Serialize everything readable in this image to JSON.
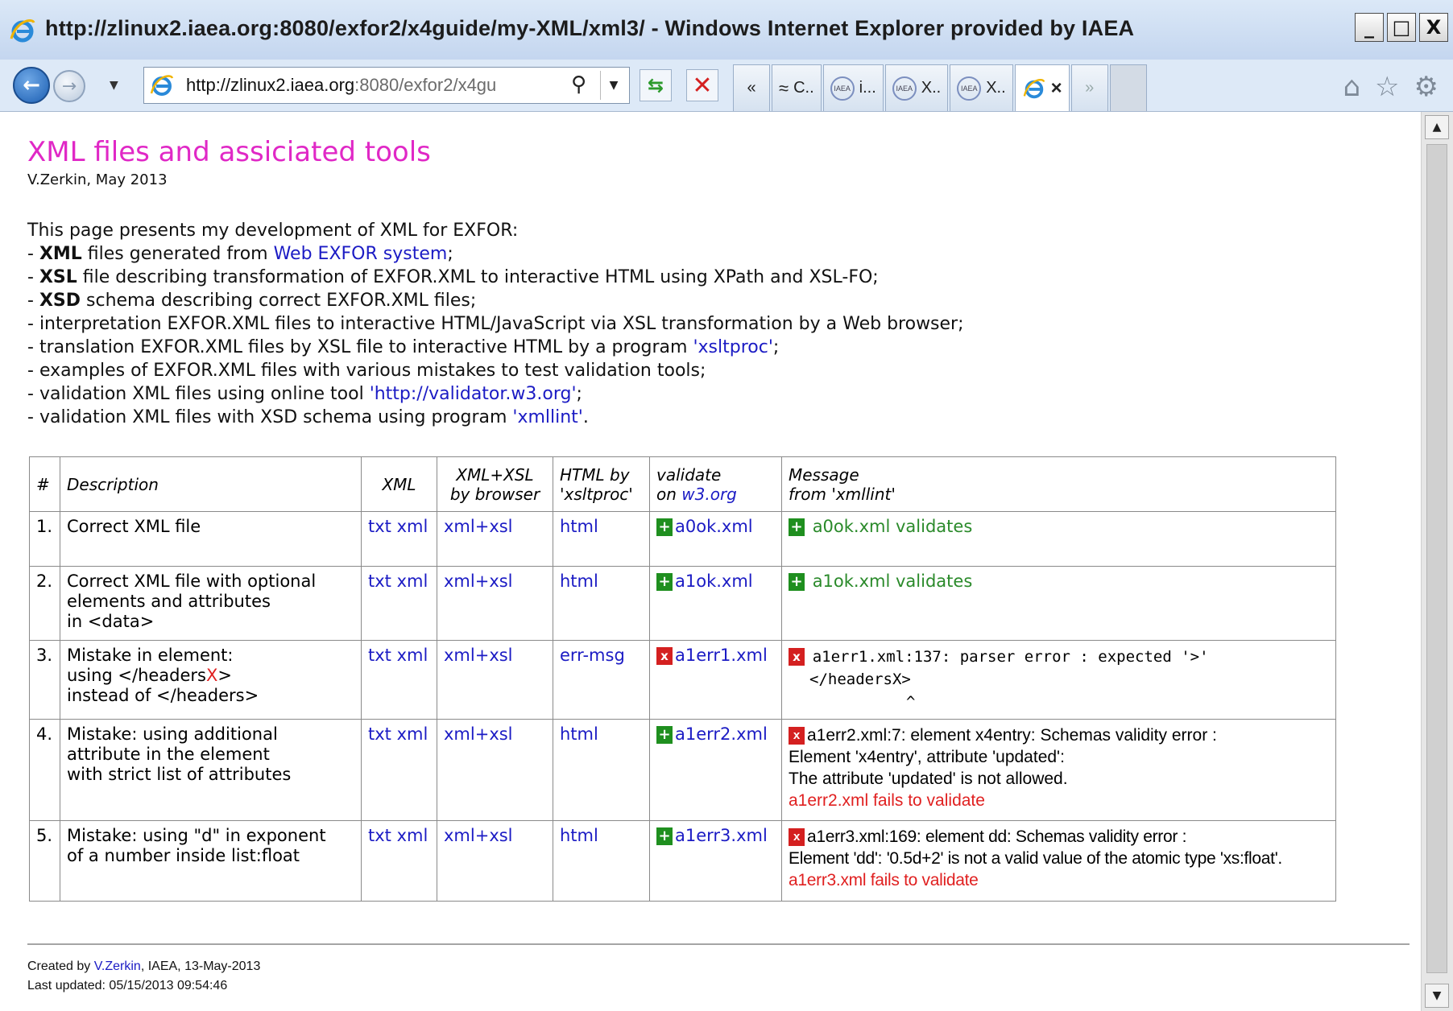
{
  "window": {
    "title": "http://zlinux2.iaea.org:8080/exfor2/x4guide/my-XML/xml3/ - Windows Internet Explorer provided by IAEA",
    "buttons": [
      "_",
      "□",
      "X"
    ]
  },
  "navbar": {
    "address_host": "http://zlinux2.iaea.org",
    "address_rest": ":8080/exfor2/x4gu",
    "tabs": [
      {
        "label": "«",
        "icon": "tab-scroll-left-icon"
      },
      {
        "label": "C..",
        "icon": "chart-page-icon"
      },
      {
        "label": "i...",
        "icon": "iaea-logo-icon"
      },
      {
        "label": "X..",
        "icon": "iaea-logo-icon"
      },
      {
        "label": "X..",
        "icon": "iaea-logo-icon"
      },
      {
        "label": "×",
        "icon": "ie-logo-icon",
        "active": true
      },
      {
        "label": "»",
        "icon": "tab-scroll-right-icon"
      }
    ],
    "icons": [
      "home-icon",
      "star-icon",
      "gear-icon"
    ]
  },
  "page": {
    "title": "XML files and assiciated tools",
    "byline": "V.Zerkin, May 2013",
    "intro": "This page presents my development of XML for EXFOR:",
    "bullets": {
      "b1_bold": "XML",
      "b1_text": " files generated from ",
      "b1_link": "Web EXFOR system",
      "b1_end": ";",
      "b2_bold": "XSL",
      "b2_text": " file describing transformation of EXFOR.XML to interactive HTML using XPath and XSL-FO;",
      "b3_bold": "XSD",
      "b3_text": " schema describing correct EXFOR.XML files;",
      "b4_text": "interpretation EXFOR.XML files to interactive HTML/JavaScript via XSL transformation by a Web browser;",
      "b5_text": "translation EXFOR.XML files by XSL file to interactive HTML by a program ",
      "b5_link": "'xsltproc'",
      "b5_end": ";",
      "b6_text": "examples of EXFOR.XML files with various mistakes to test validation tools;",
      "b7_text": "validation XML files using online tool ",
      "b7_link": "'http://validator.w3.org'",
      "b7_end": ";",
      "b8_text": "validation XML files with XSD schema using program ",
      "b8_link": "'xmllint'",
      "b8_end": "."
    },
    "table": {
      "headers": {
        "num": "#",
        "desc": "Description",
        "xml": "XML",
        "xmlxsl_1": "XML+XSL",
        "xmlxsl_2": "by browser",
        "html_1": "HTML by",
        "html_2": "'xsltproc'",
        "val_1": "validate",
        "val_2": "on ",
        "val_link": "w3.org",
        "msg_1": "Message",
        "msg_2": "from 'xmllint'"
      },
      "rows": [
        {
          "num": "1.",
          "desc_1": "Correct XML file",
          "txt": "txt",
          "xml": "xml",
          "xmlxsl": "xml+xsl",
          "html": "html",
          "val_mark": "+",
          "val_file": "a0ok.xml",
          "msg_mark": "+",
          "msg": "a0ok.xml validates"
        },
        {
          "num": "2.",
          "desc_1": "Correct XML file with optional",
          "desc_2": "elements and attributes",
          "desc_3": "in <data>",
          "txt": "txt",
          "xml": "xml",
          "xmlxsl": "xml+xsl",
          "html": "html",
          "val_mark": "+",
          "val_file": "a1ok.xml",
          "msg_mark": "+",
          "msg": "a1ok.xml validates"
        },
        {
          "num": "3.",
          "desc_1": "Mistake in element:",
          "desc_2a": "using </headers",
          "desc_2x": "X",
          "desc_2b": ">",
          "desc_3": "instead of </headers>",
          "txt": "txt",
          "xml": "xml",
          "xmlxsl": "xml+xsl",
          "html": "err-msg",
          "val_mark": "x",
          "val_file": "a1err1.xml",
          "msg_mark": "x",
          "msg_1": "a1err1.xml:137: parser error : expected '>'",
          "msg_2": "</headersX>",
          "msg_3": "^"
        },
        {
          "num": "4.",
          "desc_1": "Mistake: using additional",
          "desc_2": "attribute in the element",
          "desc_3": "with strict list of attributes",
          "txt": "txt",
          "xml": "xml",
          "xmlxsl": "xml+xsl",
          "html": "html",
          "val_mark": "+",
          "val_file": "a1err2.xml",
          "msg_mark": "x",
          "msg_1": "a1err2.xml:7: element x4entry: Schemas validity error :",
          "msg_2": "Element 'x4entry', attribute 'updated':",
          "msg_3": "The attribute 'updated' is not allowed.",
          "msg_fail": "a1err2.xml fails to validate"
        },
        {
          "num": "5.",
          "desc_1": "Mistake: using \"d\" in exponent",
          "desc_2": "of a number inside list:float",
          "txt": "txt",
          "xml": "xml",
          "xmlxsl": "xml+xsl",
          "html": "html",
          "val_mark": "+",
          "val_file": "a1err3.xml",
          "msg_mark": "x",
          "msg_1": "a1err3.xml:169: element dd: Schemas validity error :",
          "msg_2": "Element 'dd': '0.5d+2' is not a valid value of the atomic type 'xs:float'.",
          "msg_fail": "a1err3.xml fails to validate"
        }
      ]
    },
    "footer": {
      "created_prefix": "Created by ",
      "created_link": "V.Zerkin",
      "created_suffix": ", IAEA, 13-May-2013",
      "updated": "Last updated: 05/15/2013 09:54:46"
    }
  }
}
